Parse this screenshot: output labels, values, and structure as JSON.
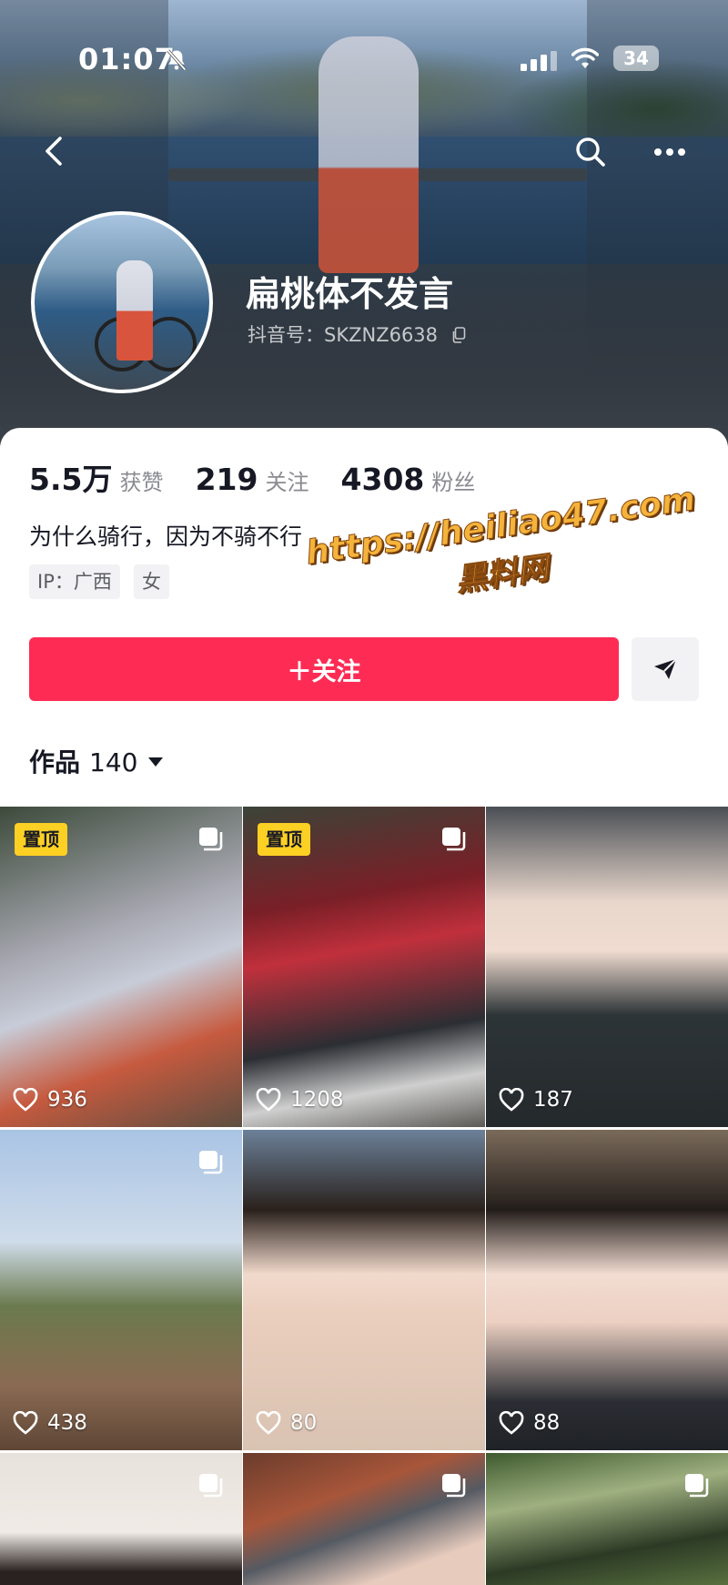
{
  "status_bar": {
    "time": "01:07",
    "battery": "34",
    "icons": [
      "bell-off-icon",
      "signal-icon",
      "wifi-icon",
      "battery-icon"
    ]
  },
  "nav": {
    "icons": [
      "back-icon",
      "search-icon",
      "more-icon"
    ]
  },
  "profile": {
    "nickname": "扁桃体不发言",
    "douyin_id": "抖音号：SKZNZ6638",
    "stats": [
      {
        "value": "5.5万",
        "label": "获赞"
      },
      {
        "value": "219",
        "label": "关注"
      },
      {
        "value": "4308",
        "label": "粉丝"
      }
    ],
    "bio": "为什么骑行，因为不骑不行",
    "tags": [
      "IP：广西",
      "女"
    ]
  },
  "actions": {
    "follow_label": "＋关注",
    "share_icon": "send-icon"
  },
  "works": {
    "label": "作品",
    "count": "140"
  },
  "watermark": {
    "line1": "https://heiliao47.com",
    "line2": "黑料网"
  },
  "grid": {
    "tiles": [
      {
        "likes": "936",
        "pinned": true,
        "pin_label": "置顶"
      },
      {
        "likes": "1208",
        "pinned": true,
        "pin_label": "置顶"
      },
      {
        "likes": "187",
        "pinned": false
      },
      {
        "likes": "438",
        "pinned": false
      },
      {
        "likes": "80",
        "pinned": false
      },
      {
        "likes": "88",
        "pinned": false
      },
      {
        "likes": "",
        "pinned": false
      },
      {
        "likes": "",
        "pinned": false
      },
      {
        "likes": "",
        "pinned": false
      }
    ]
  },
  "colors": {
    "accent": "#fe2c55",
    "pin": "#fdd024",
    "text_primary": "#161823",
    "text_secondary": "#8a8b91"
  }
}
